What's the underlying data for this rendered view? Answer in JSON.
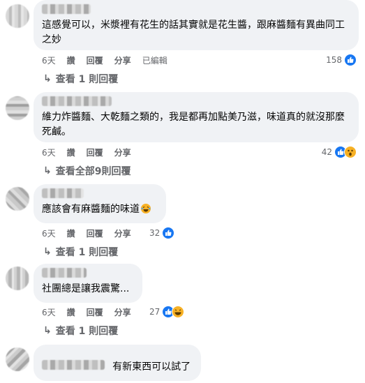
{
  "comments": [
    {
      "text": "這感覺可以，米漿裡有花生的話其實就是花生醬，跟麻醬麵有異曲同工之妙",
      "time": "6天",
      "like_label": "讚",
      "reply_label": "回覆",
      "share_label": "分享",
      "edited_label": "已編輯",
      "reaction_count": "158",
      "reactions": [
        "like-icon"
      ],
      "replies_label": "查看 1 則回覆"
    },
    {
      "text": "維力炸醬麵、大乾麵之類的，我是都再加點美乃滋，味道真的就沒那麼死鹹。",
      "time": "6天",
      "like_label": "讚",
      "reply_label": "回覆",
      "share_label": "分享",
      "reaction_count": "42",
      "reactions": [
        "like-icon",
        "wow-icon"
      ],
      "replies_label": "查看全部9則回覆"
    },
    {
      "text": "應該會有麻醬麵的味道",
      "emoji": "laughing-tears-emoji",
      "time": "6天",
      "like_label": "讚",
      "reply_label": "回覆",
      "share_label": "分享",
      "reaction_count": "32",
      "reactions": [
        "like-icon"
      ],
      "replies_label": "查看 1 則回覆"
    },
    {
      "text": "社團總是讓我震驚...",
      "time": "6天",
      "like_label": "讚",
      "reply_label": "回覆",
      "share_label": "分享",
      "reaction_count": "27",
      "reactions": [
        "like-icon",
        "haha-icon"
      ],
      "replies_label": "查看 1 則回覆"
    },
    {
      "text": "有新東西可以試了"
    }
  ],
  "colors": {
    "bubble": "#f0f2f5",
    "meta_text": "#65676b",
    "like_blue": "#1877f2",
    "emoji_yellow": "#f7b125"
  }
}
